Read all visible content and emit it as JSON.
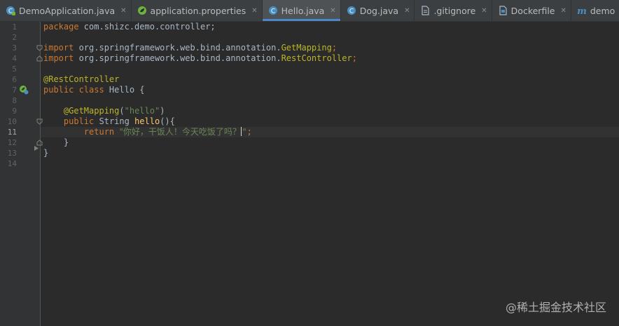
{
  "tabs": [
    {
      "label": "DemoApplication.java",
      "icon": "spring-java-class-icon",
      "active": false
    },
    {
      "label": "application.properties",
      "icon": "spring-properties-icon",
      "active": false
    },
    {
      "label": "Hello.java",
      "icon": "java-class-icon",
      "active": true
    },
    {
      "label": "Dog.java",
      "icon": "java-class-icon",
      "active": false
    },
    {
      "label": ".gitignore",
      "icon": "text-file-icon",
      "active": false
    },
    {
      "label": "Dockerfile",
      "icon": "docker-file-icon",
      "active": false
    },
    {
      "label": "demo",
      "icon": "maven-icon",
      "active": false
    }
  ],
  "close_glyph": "✕",
  "line_numbers": [
    "1",
    "2",
    "3",
    "4",
    "5",
    "6",
    "7",
    "8",
    "9",
    "10",
    "11",
    "12",
    "13",
    "14"
  ],
  "current_line": "11",
  "code": {
    "l1_kw": "package",
    "l1_rest": " com.shizc.demo.controller;",
    "l3_kw": "import",
    "l3_pkg": " org.springframework.web.bind.annotation.",
    "l3_cls": "GetMapping",
    "l3_end": ";",
    "l4_kw": "import",
    "l4_pkg": " org.springframework.web.bind.annotation.",
    "l4_cls": "RestController",
    "l4_end": ";",
    "l6_ann": "@RestController",
    "l7_kw": "public class",
    "l7_rest": " Hello {",
    "l9_ann": "@GetMapping",
    "l9_paren_open": "(",
    "l9_str": "\"hello\"",
    "l9_paren_close": ")",
    "l10_kw": "public",
    "l10_type": " String ",
    "l10_fn": "hello",
    "l10_rest": "(){",
    "l11_kw": "return",
    "l11_space": " ",
    "l11_str_a": "\"你好，干饭人！今天吃饭了吗？",
    "l11_str_b": "\"",
    "l11_end": ";",
    "l12": "}",
    "l13": "}"
  },
  "watermark": "@稀土掘金技术社区",
  "colors": {
    "background": "#2b2b2b",
    "keyword": "#cc7832",
    "annotation": "#bbb529",
    "string": "#6a8759",
    "function": "#ffc66d",
    "text": "#a9b7c6",
    "active_tab_underline": "#4a88c7"
  }
}
